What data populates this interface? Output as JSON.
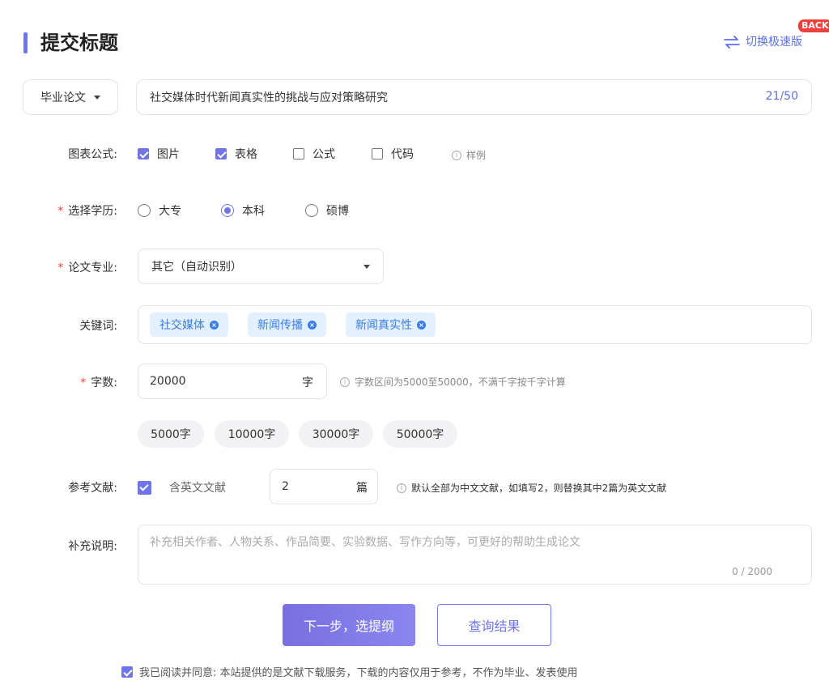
{
  "header": {
    "title": "提交标题",
    "back_badge": "BACK",
    "switch_label": "切换极速版",
    "accent_color": "#6f74e6"
  },
  "title_row": {
    "type_select_value": "毕业论文",
    "title_value": "社交媒体时代新闻真实性的挑战与应对策略研究",
    "char_count": "21/50"
  },
  "figures": {
    "label": "图表公式:",
    "options": [
      {
        "label": "图片",
        "checked": true
      },
      {
        "label": "表格",
        "checked": true
      },
      {
        "label": "公式",
        "checked": false
      },
      {
        "label": "代码",
        "checked": false
      }
    ],
    "hint": "样例"
  },
  "education": {
    "label": "选择学历:",
    "options": [
      {
        "label": "大专",
        "selected": false
      },
      {
        "label": "本科",
        "selected": true
      },
      {
        "label": "硕博",
        "selected": false
      }
    ]
  },
  "major": {
    "label": "论文专业:",
    "value": "其它（自动识别）"
  },
  "keywords": {
    "label": "关键词:",
    "tags": [
      "社交媒体",
      "新闻传播",
      "新闻真实性"
    ]
  },
  "word_count": {
    "label": "字数:",
    "value": "20000",
    "unit": "字",
    "hint": "字数区间为5000至50000，不满千字按千字计算",
    "presets": [
      "5000字",
      "10000字",
      "30000字",
      "50000字"
    ]
  },
  "references": {
    "label": "参考文献:",
    "include_english_label": "含英文文献",
    "include_english_checked": true,
    "count_value": "2",
    "count_unit": "篇",
    "hint": "默认全部为中文文献，如填写2，则替换其中2篇为英文文献"
  },
  "notes": {
    "label": "补充说明:",
    "placeholder": "补充相关作者、人物关系、作品简要、实验数据、写作方向等，可更好的帮助生成论文",
    "count": "0 / 2000"
  },
  "actions": {
    "next_label": "下一步，选提纲",
    "query_label": "查询结果"
  },
  "agreement": {
    "checked": true,
    "text": "我已阅读并同意: 本站提供的是文献下载服务，下载的内容仅用于参考，不作为毕业、发表使用"
  }
}
